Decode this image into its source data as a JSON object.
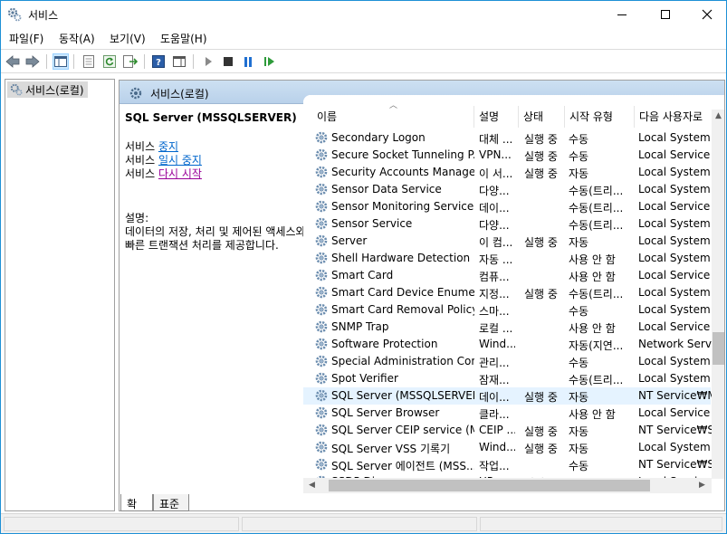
{
  "window": {
    "title": "서비스",
    "controls": {
      "minimize": "minimize-icon",
      "maximize": "maximize-icon",
      "close": "close-icon"
    }
  },
  "menu": [
    "파일(F)",
    "동작(A)",
    "보기(V)",
    "도움말(H)"
  ],
  "toolbar": {
    "icons": [
      "back-icon",
      "forward-icon",
      "show-console-tree-icon",
      "properties-icon",
      "refresh-icon",
      "export-list-icon",
      "help-icon",
      "show-hide-action-pane-icon",
      "start-service-icon",
      "stop-service-icon",
      "pause-service-icon",
      "resume-service-icon"
    ]
  },
  "tree": {
    "item": "서비스(로컬)"
  },
  "pane_header": {
    "title": "서비스(로컬)"
  },
  "detail": {
    "service_name": "SQL Server (MSSQLSERVER)",
    "actions": [
      {
        "prefix": "서비스 ",
        "link": "중지"
      },
      {
        "prefix": "서비스 ",
        "link": "일시 중지"
      },
      {
        "prefix": "서비스 ",
        "link": "다시 시작"
      }
    ],
    "desc_label": "설명:",
    "description": "데이터의 저장, 처리 및 제어된 액세스와 빠른 트랜잭션 처리를 제공합니다."
  },
  "list": {
    "columns": [
      "이름",
      "설명",
      "상태",
      "시작 유형",
      "다음 사용자로"
    ],
    "rows": [
      {
        "name": "Secondary Logon",
        "desc": "대체 ...",
        "status": "실행 중",
        "start": "수동",
        "logon": "Local System"
      },
      {
        "name": "Secure Socket Tunneling P...",
        "desc": "VPN...",
        "status": "실행 중",
        "start": "수동",
        "logon": "Local Service"
      },
      {
        "name": "Security Accounts Manager",
        "desc": "이 서...",
        "status": "실행 중",
        "start": "자동",
        "logon": "Local System"
      },
      {
        "name": "Sensor Data Service",
        "desc": "다양...",
        "status": "",
        "start": "수동(트리...",
        "logon": "Local System"
      },
      {
        "name": "Sensor Monitoring Service",
        "desc": "데이...",
        "status": "",
        "start": "수동(트리...",
        "logon": "Local Service"
      },
      {
        "name": "Sensor Service",
        "desc": "다양...",
        "status": "",
        "start": "수동(트리...",
        "logon": "Local System"
      },
      {
        "name": "Server",
        "desc": "이 컴...",
        "status": "실행 중",
        "start": "자동",
        "logon": "Local System"
      },
      {
        "name": "Shell Hardware Detection",
        "desc": "자동 ...",
        "status": "",
        "start": "사용 안 함",
        "logon": "Local System"
      },
      {
        "name": "Smart Card",
        "desc": "컴퓨...",
        "status": "",
        "start": "사용 안 함",
        "logon": "Local Service"
      },
      {
        "name": "Smart Card Device Enumer...",
        "desc": "지정...",
        "status": "실행 중",
        "start": "수동(트리...",
        "logon": "Local System"
      },
      {
        "name": "Smart Card Removal Policy",
        "desc": "스마...",
        "status": "",
        "start": "수동",
        "logon": "Local System"
      },
      {
        "name": "SNMP Trap",
        "desc": "로컬 ...",
        "status": "",
        "start": "사용 안 함",
        "logon": "Local Service"
      },
      {
        "name": "Software Protection",
        "desc": "Wind...",
        "status": "",
        "start": "자동(지연...",
        "logon": "Network Servic"
      },
      {
        "name": "Special Administration Con...",
        "desc": "관리...",
        "status": "",
        "start": "수동",
        "logon": "Local System"
      },
      {
        "name": "Spot Verifier",
        "desc": "잠재...",
        "status": "",
        "start": "수동(트리...",
        "logon": "Local System"
      },
      {
        "name": "SQL Server (MSSQLSERVER)",
        "desc": "데이...",
        "status": "실행 중",
        "start": "자동",
        "logon": "NT Service₩M",
        "selected": true
      },
      {
        "name": "SQL Server Browser",
        "desc": "클라...",
        "status": "",
        "start": "사용 안 함",
        "logon": "Local Service"
      },
      {
        "name": "SQL Server CEIP service (M...",
        "desc": "CEIP ...",
        "status": "실행 중",
        "start": "자동",
        "logon": "NT Service₩SC"
      },
      {
        "name": "SQL Server VSS 기록기",
        "desc": "Wind...",
        "status": "실행 중",
        "start": "자동",
        "logon": "Local System"
      },
      {
        "name": "SQL Server 에이전트 (MSS...",
        "desc": "작업...",
        "status": "",
        "start": "수동",
        "logon": "NT Service₩SC"
      },
      {
        "name": "SSDP Discovery",
        "desc": "UPn...",
        "status": "실행 중",
        "start": "수동",
        "logon": "Local Service"
      }
    ]
  },
  "tabs": [
    "확장",
    "표준"
  ]
}
